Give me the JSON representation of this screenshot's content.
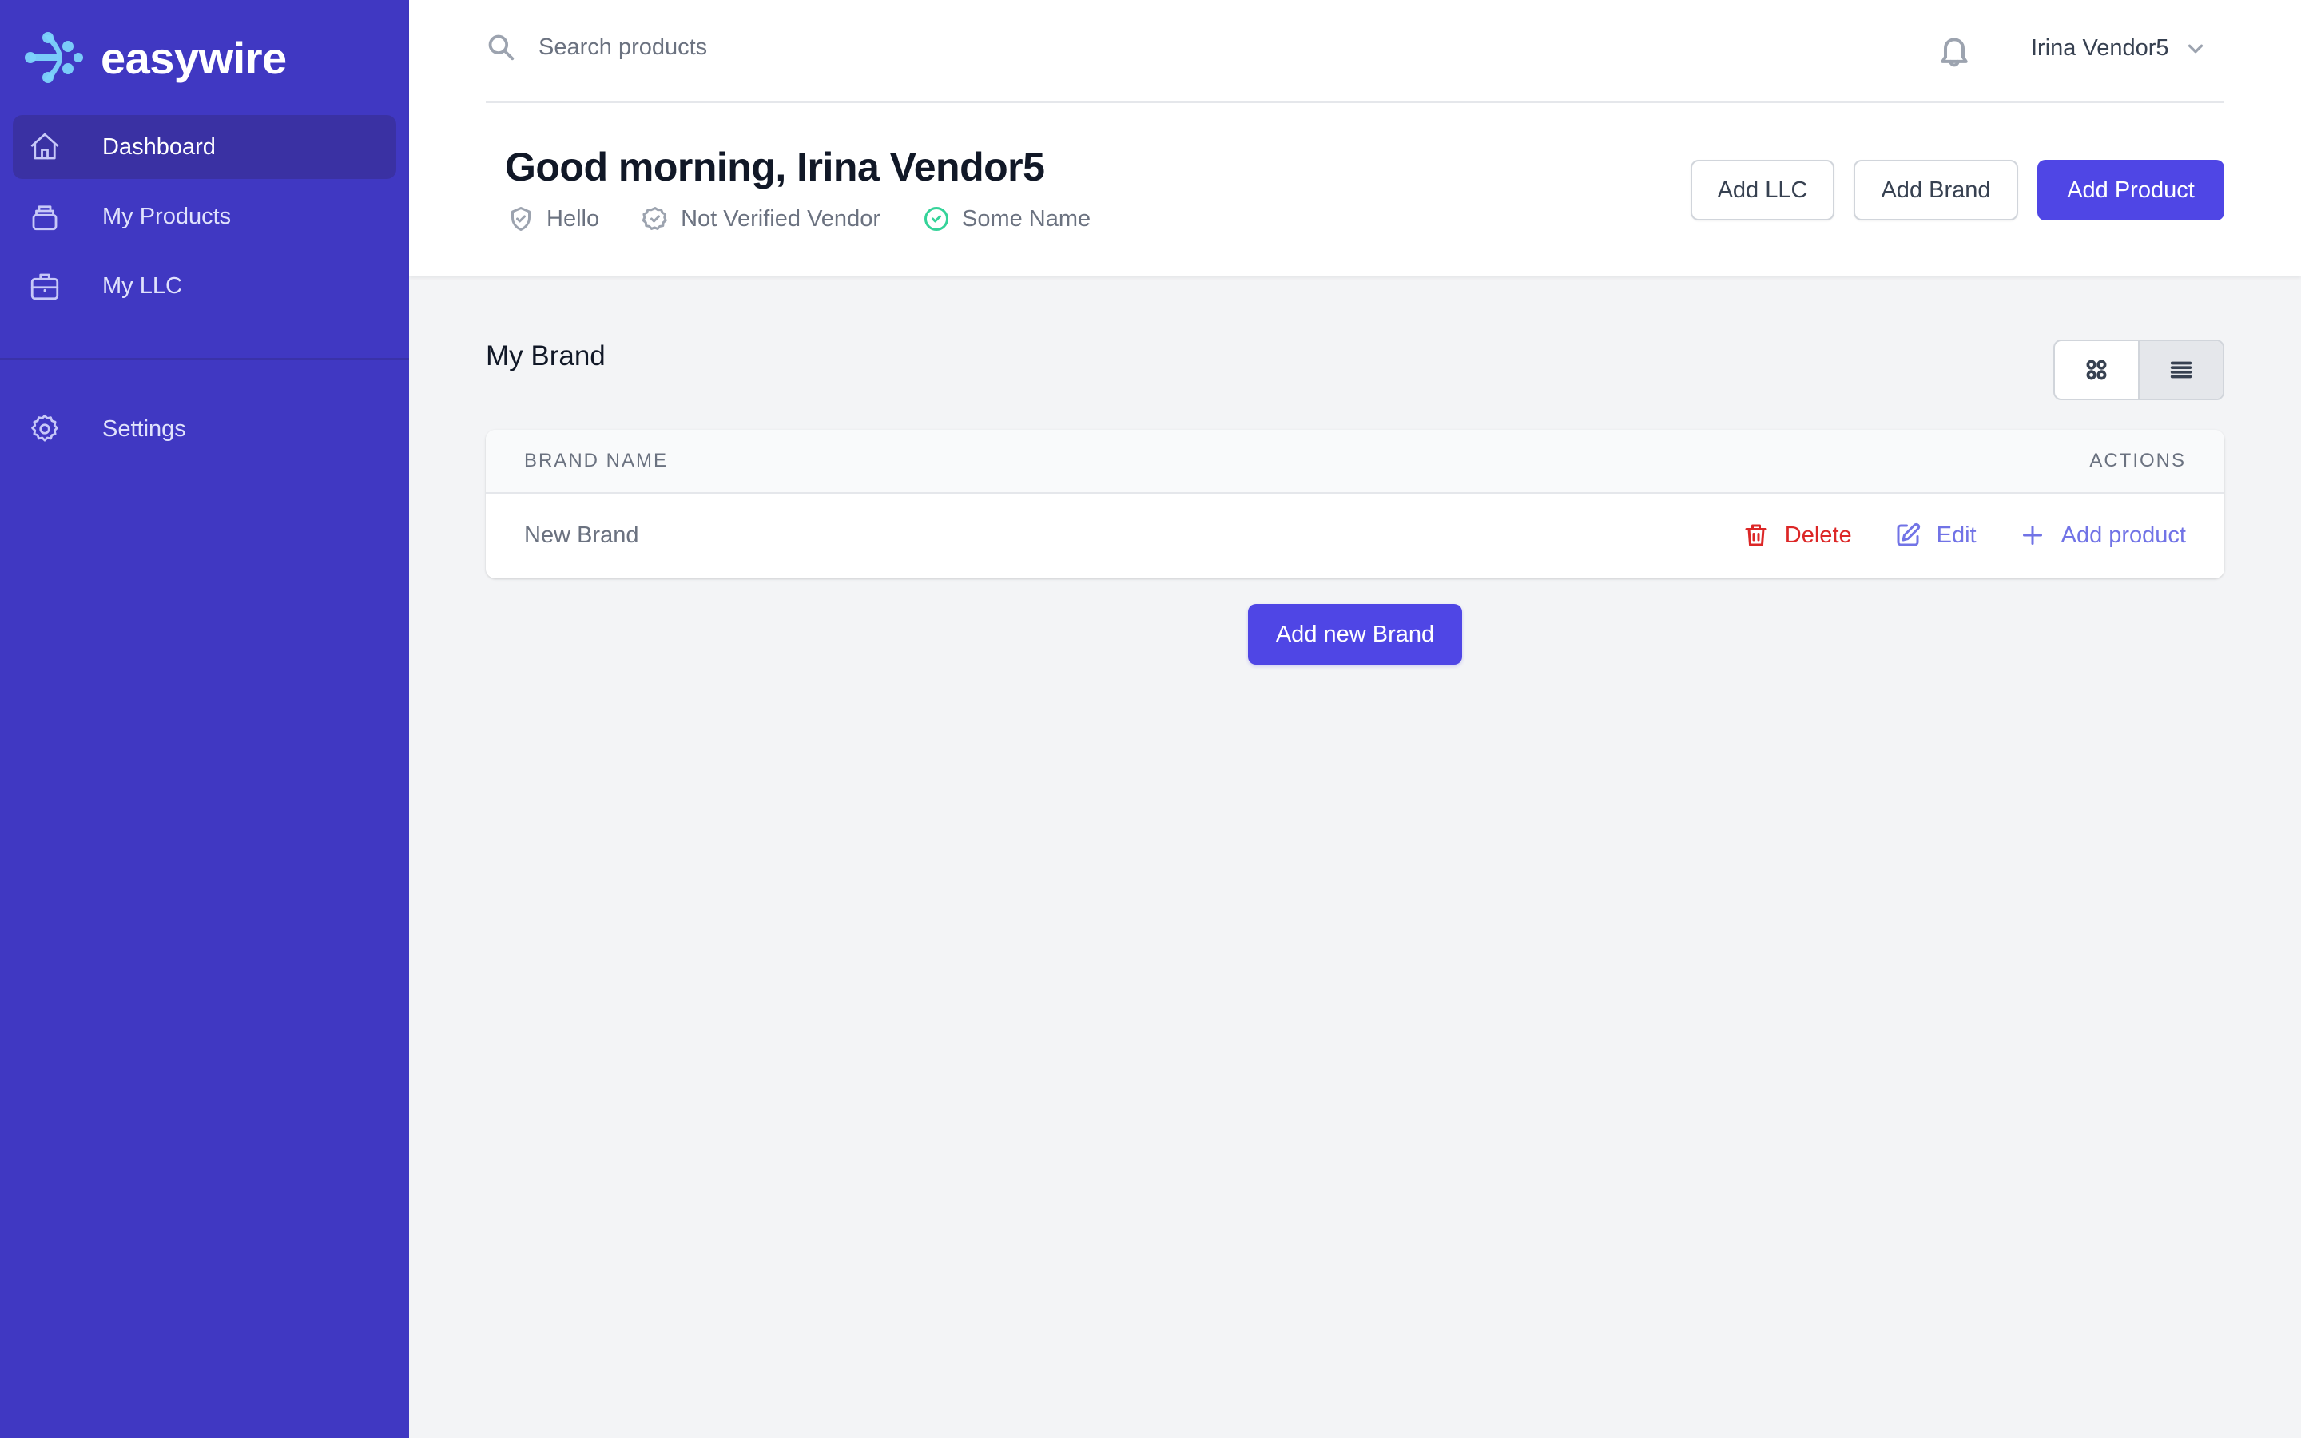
{
  "app": {
    "brand_name": "easywire",
    "brand_color": "#4038c2",
    "accent_color": "#4f46e5"
  },
  "sidebar": {
    "items": [
      {
        "label": "Dashboard",
        "icon": "home-icon",
        "active": true
      },
      {
        "label": "My Products",
        "icon": "products-icon",
        "active": false
      },
      {
        "label": "My LLC",
        "icon": "briefcase-icon",
        "active": false
      }
    ],
    "secondary_items": [
      {
        "label": "Settings",
        "icon": "gear-icon",
        "active": false
      }
    ]
  },
  "header": {
    "search": {
      "placeholder": "Search products",
      "value": ""
    },
    "user_name": "Irina Vendor5",
    "greeting": "Good morning, Irina Vendor5",
    "badges": [
      {
        "label": "Hello",
        "icon": "shield-check-icon",
        "color": "#9ca3af"
      },
      {
        "label": "Not Verified Vendor",
        "icon": "badge-check-icon",
        "color": "#9ca3af"
      },
      {
        "label": "Some Name",
        "icon": "check-circle-icon",
        "color": "#34d399"
      }
    ],
    "buttons": {
      "add_llc": "Add LLC",
      "add_brand": "Add Brand",
      "add_product": "Add Product"
    }
  },
  "main": {
    "section_title": "My Brand",
    "view_mode": "list",
    "table": {
      "columns": [
        "BRAND NAME",
        "ACTIONS"
      ],
      "rows": [
        {
          "brand_name": "New Brand",
          "actions": [
            "Delete",
            "Edit",
            "Add product"
          ]
        }
      ]
    },
    "add_new_brand_label": "Add new Brand"
  }
}
